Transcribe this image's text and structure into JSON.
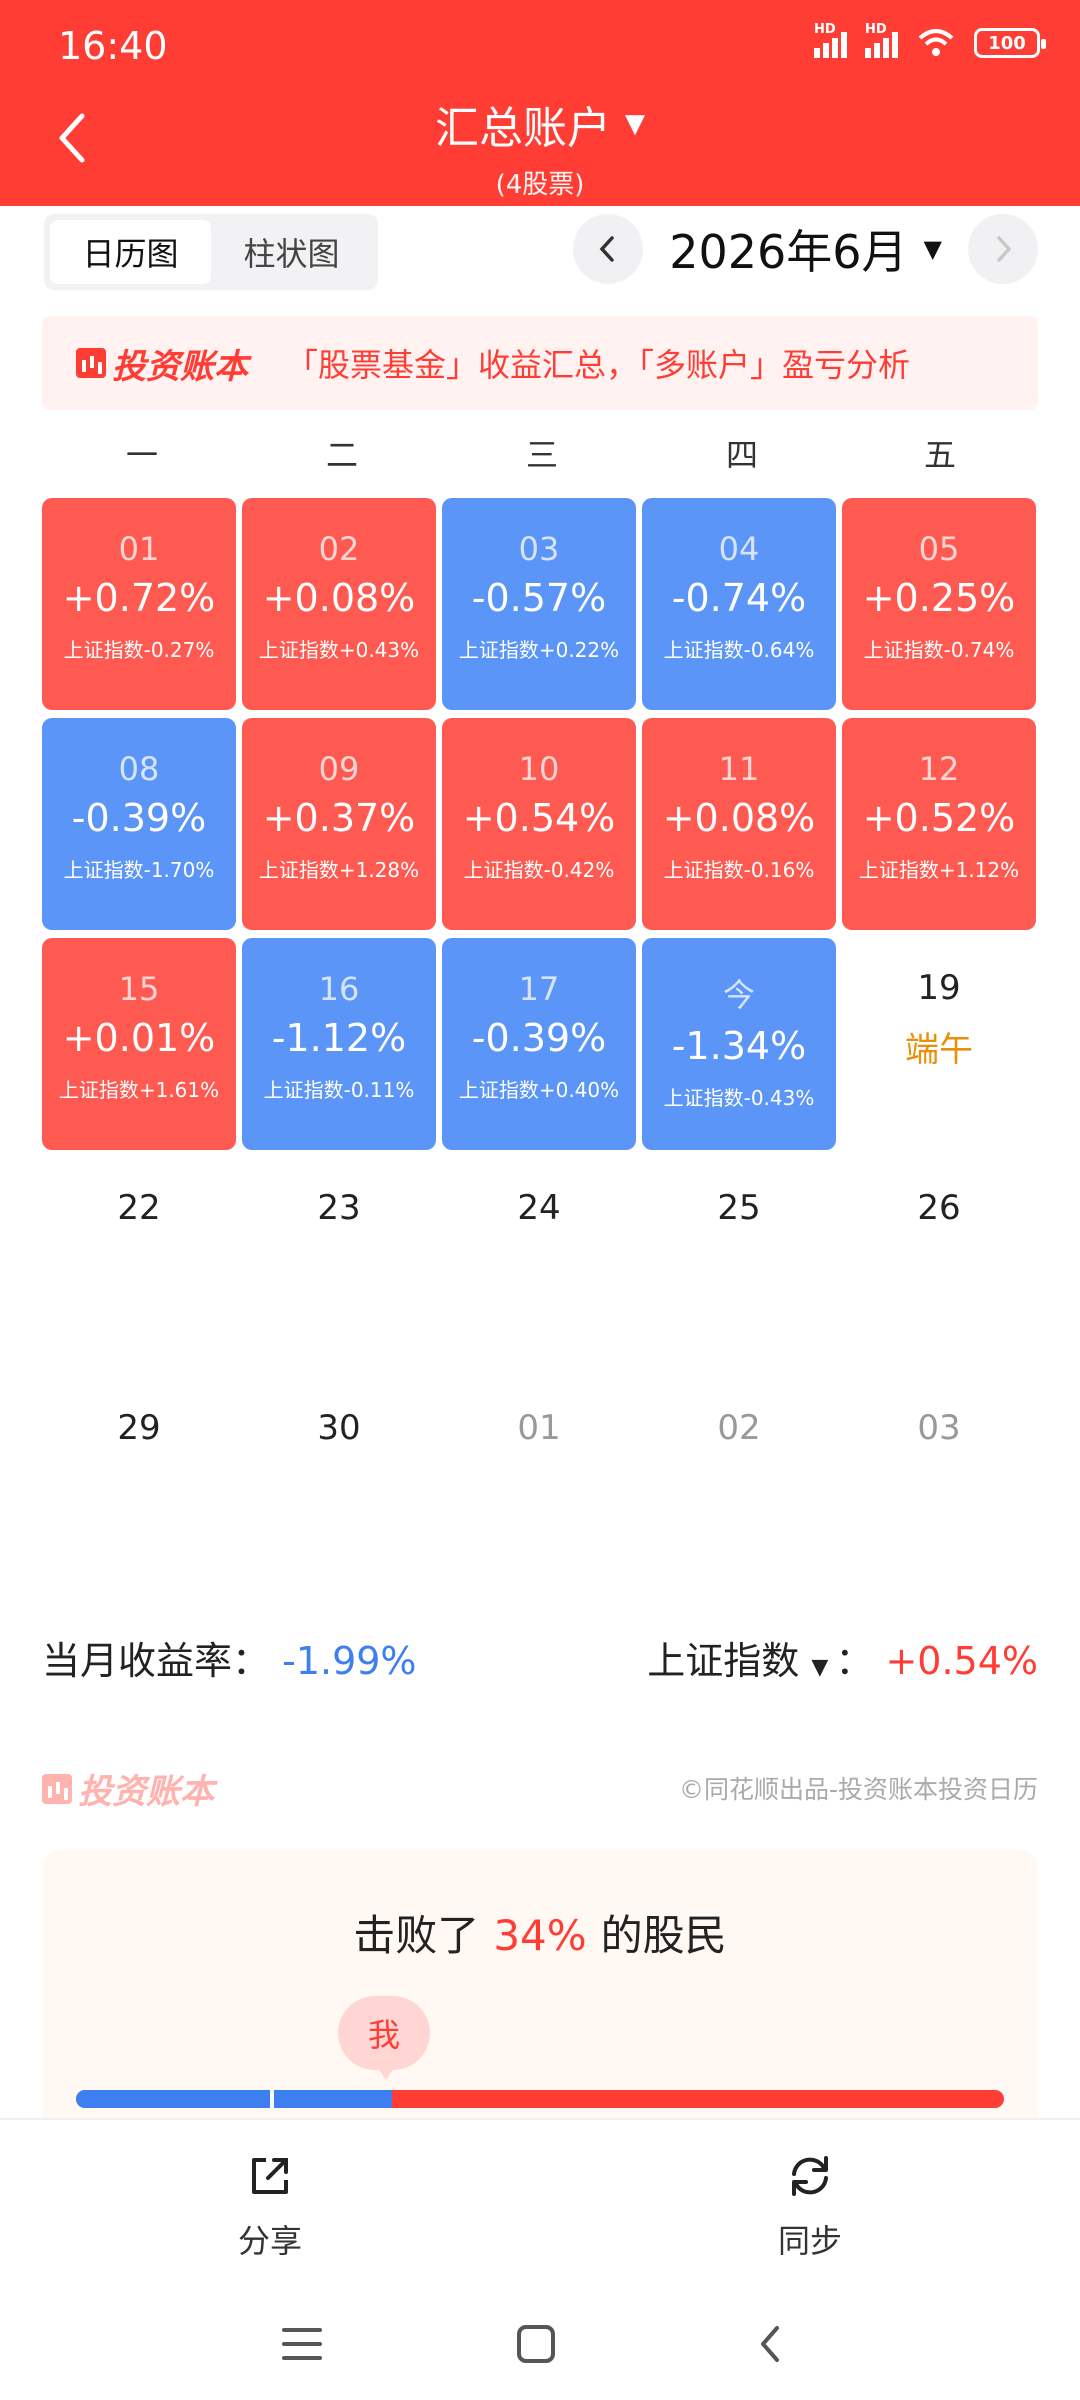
{
  "status_bar": {
    "time": "16:40",
    "battery": "100",
    "signal_label": "HD"
  },
  "header": {
    "title": "汇总账户",
    "subtitle": "(4股票)"
  },
  "view_tabs": [
    {
      "label": "日历图",
      "active": true
    },
    {
      "label": "柱状图",
      "active": false
    }
  ],
  "month": {
    "label": "2026年6月"
  },
  "banner": {
    "logo_text": "投资账本",
    "text": "「股票基金」收益汇总，「多账户」盈亏分析"
  },
  "weekdays": [
    "一",
    "二",
    "三",
    "四",
    "五"
  ],
  "calendar": {
    "rows": [
      [
        {
          "day": "01",
          "return": "+0.72%",
          "index": "上证指数-0.27%",
          "trend": "up"
        },
        {
          "day": "02",
          "return": "+0.08%",
          "index": "上证指数+0.43%",
          "trend": "up"
        },
        {
          "day": "03",
          "return": "-0.57%",
          "index": "上证指数+0.22%",
          "trend": "down"
        },
        {
          "day": "04",
          "return": "-0.74%",
          "index": "上证指数-0.64%",
          "trend": "down"
        },
        {
          "day": "05",
          "return": "+0.25%",
          "index": "上证指数-0.74%",
          "trend": "up"
        }
      ],
      [
        {
          "day": "08",
          "return": "-0.39%",
          "index": "上证指数-1.70%",
          "trend": "down"
        },
        {
          "day": "09",
          "return": "+0.37%",
          "index": "上证指数+1.28%",
          "trend": "up"
        },
        {
          "day": "10",
          "return": "+0.54%",
          "index": "上证指数-0.42%",
          "trend": "up"
        },
        {
          "day": "11",
          "return": "+0.08%",
          "index": "上证指数-0.16%",
          "trend": "up"
        },
        {
          "day": "12",
          "return": "+0.52%",
          "index": "上证指数+1.12%",
          "trend": "up"
        }
      ],
      [
        {
          "day": "15",
          "return": "+0.01%",
          "index": "上证指数+1.61%",
          "trend": "up"
        },
        {
          "day": "16",
          "return": "-1.12%",
          "index": "上证指数-0.11%",
          "trend": "down"
        },
        {
          "day": "17",
          "return": "-0.39%",
          "index": "上证指数+0.40%",
          "trend": "down"
        },
        {
          "day": "今",
          "return": "-1.34%",
          "index": "上证指数-0.43%",
          "trend": "down"
        },
        {
          "day": "19",
          "holiday": "端午",
          "trend": "none"
        }
      ],
      [
        {
          "day": "22",
          "trend": "none"
        },
        {
          "day": "23",
          "trend": "none"
        },
        {
          "day": "24",
          "trend": "none"
        },
        {
          "day": "25",
          "trend": "none"
        },
        {
          "day": "26",
          "trend": "none"
        }
      ],
      [
        {
          "day": "29",
          "trend": "none"
        },
        {
          "day": "30",
          "trend": "none"
        },
        {
          "day": "01",
          "trend": "none",
          "muted": true
        },
        {
          "day": "02",
          "trend": "none",
          "muted": true
        },
        {
          "day": "03",
          "trend": "none",
          "muted": true
        }
      ]
    ]
  },
  "summary": {
    "month_return_label": "当月收益率：",
    "month_return_value": "-1.99%",
    "index_label": "上证指数",
    "index_separator": "：",
    "index_value": "+0.54%"
  },
  "brand": {
    "logo_text": "投资账本",
    "credit": "©同花顺出品-投资账本投资日历"
  },
  "beat": {
    "prefix": "击败了",
    "percent": "34%",
    "suffix": "的股民",
    "me_label": "我",
    "progress_fraction": 0.34
  },
  "actions": {
    "share": "分享",
    "sync": "同步"
  },
  "colors": {
    "header": "#ff3d34",
    "up": "#ff5a52",
    "down": "#5b95f7",
    "holiday": "#e8900a"
  }
}
